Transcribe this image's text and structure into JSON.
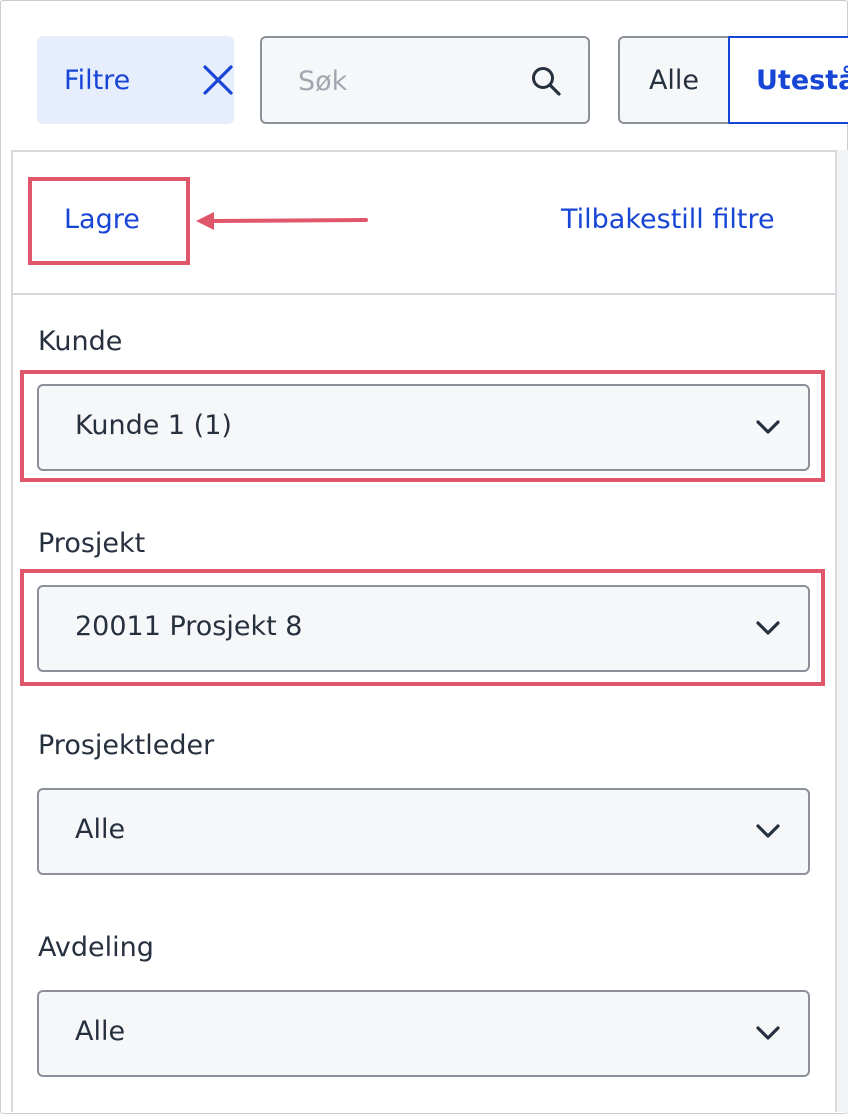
{
  "toolbar": {
    "filter_label": "Filtre",
    "search_placeholder": "Søk",
    "segments": [
      "Alle",
      "Utestå"
    ]
  },
  "panel": {
    "save_label": "Lagre",
    "reset_label": "Tilbakestill filtre",
    "fields": [
      {
        "label": "Kunde",
        "value": "Kunde 1 (1)"
      },
      {
        "label": "Prosjekt",
        "value": "20011 Prosjekt 8"
      },
      {
        "label": "Prosjektleder",
        "value": "Alle"
      },
      {
        "label": "Avdeling",
        "value": "Alle"
      }
    ]
  },
  "colors": {
    "accent": "#1745d6",
    "filter_bg": "#e6edfc",
    "highlight": "#e0566a",
    "text": "#27303f",
    "field_bg": "#f6f7f9"
  },
  "icons": {
    "filter_close": "close-icon",
    "search": "search-icon",
    "dropdown": "chevron-down-icon",
    "annotation": "arrow-left-icon"
  }
}
